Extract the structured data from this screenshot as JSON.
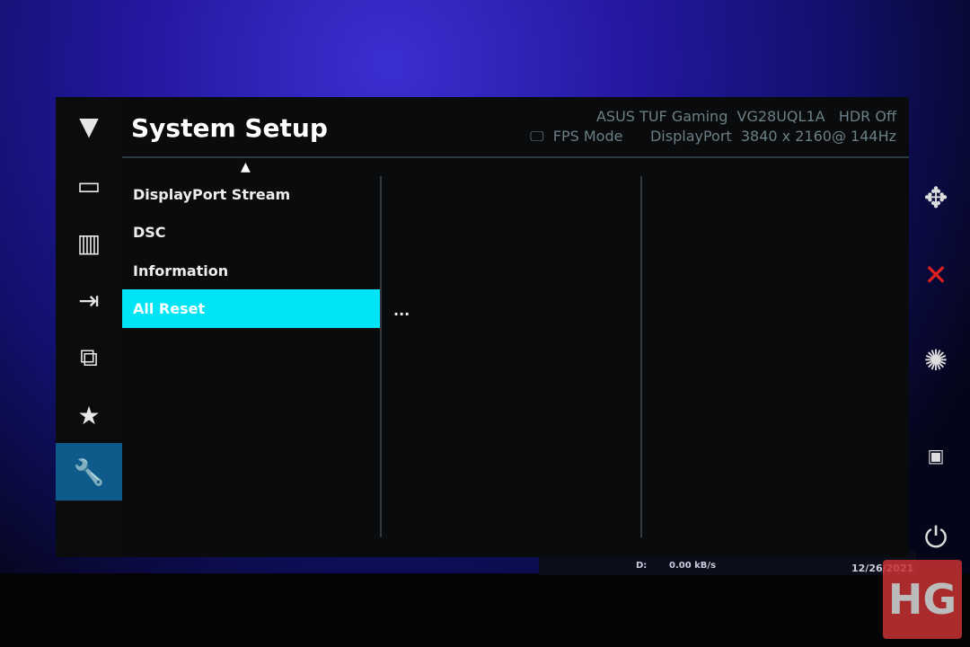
{
  "header": {
    "title": "System Setup",
    "brand": "ASUS TUF Gaming",
    "model": "VG28UQL1A",
    "hdr": "HDR Off",
    "mode": "FPS Mode",
    "input": "DisplayPort",
    "resolution": "3840 x 2160@ 144Hz"
  },
  "menu": {
    "items": [
      {
        "label": "DisplayPort Stream"
      },
      {
        "label": "DSC"
      },
      {
        "label": "Information"
      },
      {
        "label": "All Reset"
      }
    ],
    "selected": "All Reset",
    "submenu_value": "..."
  },
  "sidebar": {
    "icons": [
      "tuf-logo-icon",
      "image-icon",
      "color-icon",
      "input-select-icon",
      "pip-icon",
      "favorite-star-icon",
      "system-setup-wrench-icon"
    ],
    "active": "system-setup-wrench-icon"
  },
  "right_keys": [
    "navigate-joystick-icon",
    "close-icon",
    "brightness-icon",
    "gameplus-icon",
    "power-icon"
  ],
  "taskbar": {
    "drive": "D:",
    "speed": "0.00 kB/s",
    "date": "12/26/2021"
  },
  "watermark": "HG",
  "colors": {
    "accent": "#00e5f5",
    "active_sidebar": "#0e5a8a",
    "close": "#e02020"
  }
}
